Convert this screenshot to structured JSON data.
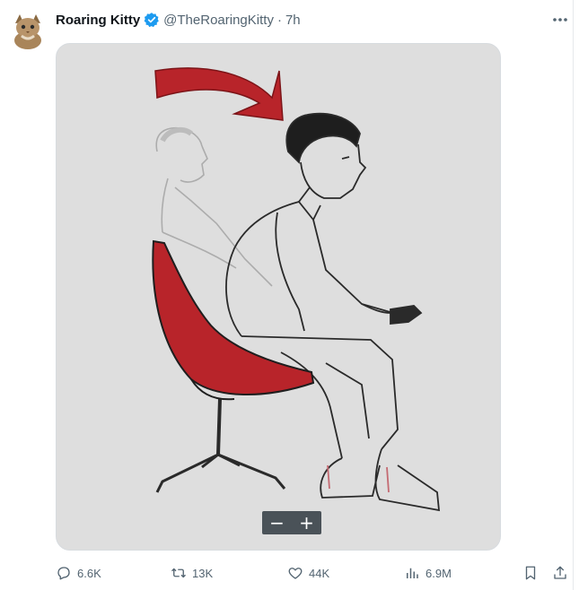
{
  "tweet": {
    "display_name": "Roaring Kitty",
    "handle": "@TheRoaringKitty",
    "separator": "·",
    "time": "7h",
    "verified": true,
    "accent_color": "#1d9bf0",
    "avatar_icon": "kitten-avatar-icon"
  },
  "media": {
    "zoom_out_label": "−",
    "zoom_in_label": "+",
    "arrow_color": "#b8242a",
    "chair_color": "#b8242a"
  },
  "actions": {
    "replies": "6.6K",
    "reposts": "13K",
    "likes": "44K",
    "views": "6.9M"
  },
  "icons": [
    "reply-icon",
    "repost-icon",
    "like-icon",
    "views-icon",
    "bookmark-icon",
    "share-icon",
    "more-icon",
    "verified-icon"
  ]
}
